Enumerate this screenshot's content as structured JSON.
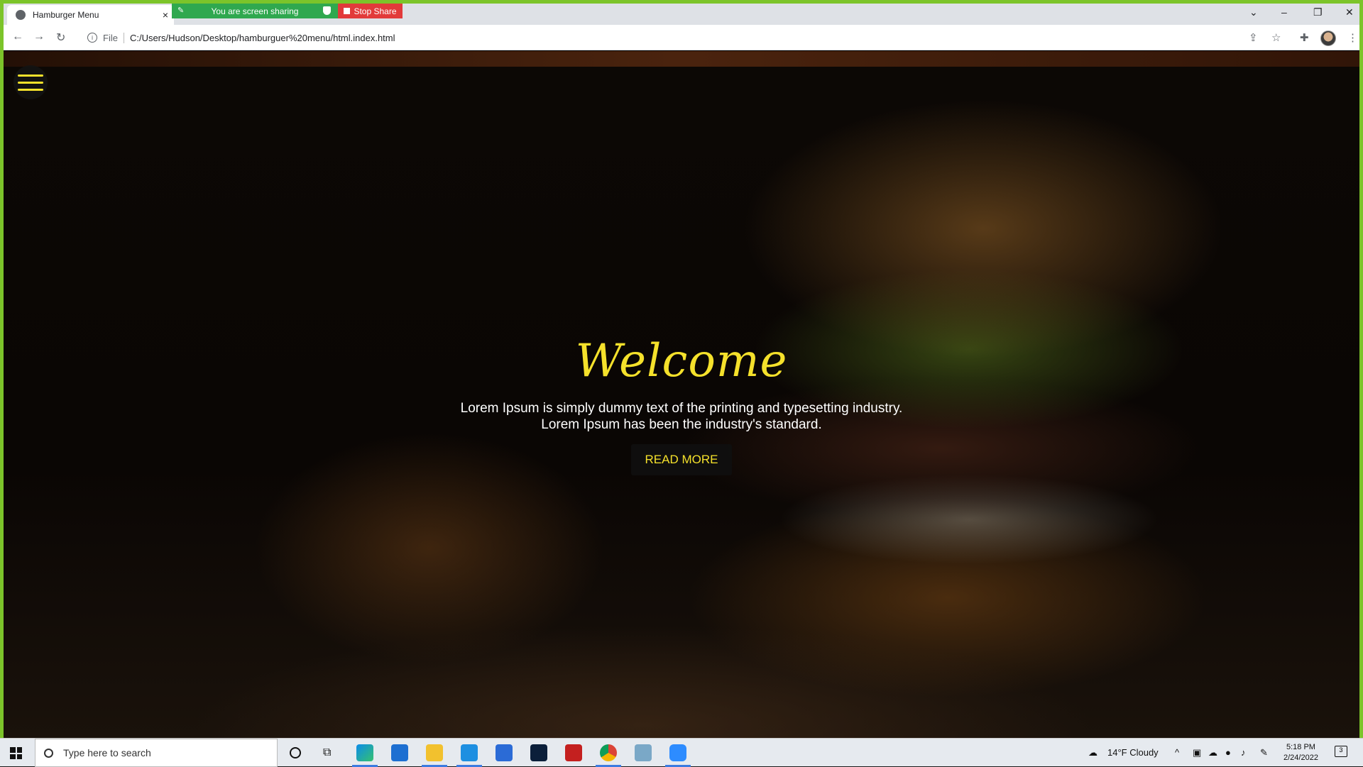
{
  "browser": {
    "tab_title": "Hamburger Menu",
    "tab_close": "×",
    "screen_share_text": "You are screen sharing",
    "stop_share_label": "Stop Share",
    "file_label": "File",
    "url": "C:/Users/Hudson/Desktop/hamburguer%20menu/html.index.html"
  },
  "page": {
    "heading": "Welcome",
    "description_line1": "Lorem Ipsum is simply dummy text of the printing and typesetting industry.",
    "description_line2": "Lorem Ipsum has been the industry's standard.",
    "button_label": "READ MORE",
    "colors": {
      "accent": "#f5e12b",
      "button_bg": "#0f0f0f"
    }
  },
  "taskbar": {
    "search_placeholder": "Type here to search",
    "weather": "14°F  Cloudy",
    "time": "5:18 PM",
    "date": "2/24/2022",
    "notification_count": "3",
    "apps": [
      "edge-icon",
      "mail-icon",
      "file-explorer-icon",
      "vscode-icon",
      "store-icon",
      "lightroom-icon",
      "filezilla-icon",
      "chrome-icon",
      "app-icon",
      "zoom-icon"
    ]
  }
}
